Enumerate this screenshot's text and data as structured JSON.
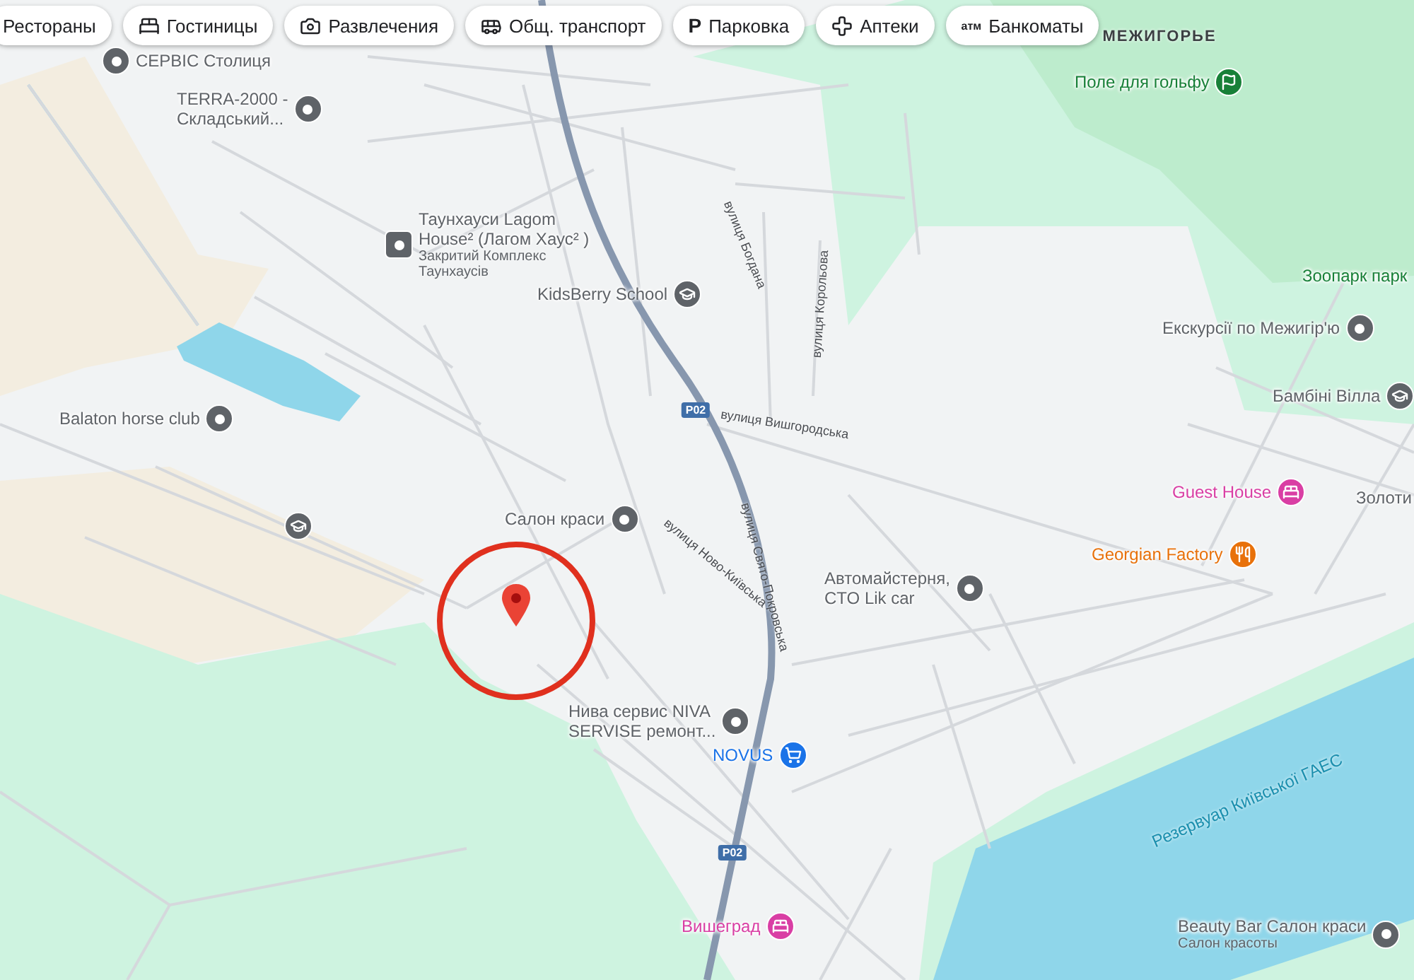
{
  "chips": [
    {
      "label": "Рестораны",
      "kind": "none"
    },
    {
      "label": "Гостиницы",
      "kind": "bed"
    },
    {
      "label": "Развлечения",
      "kind": "camera"
    },
    {
      "label": "Общ. транспорт",
      "kind": "bus"
    },
    {
      "label": "Парковка",
      "kind": "glyph",
      "glyph": "P"
    },
    {
      "label": "Аптеки",
      "kind": "pharmacy"
    },
    {
      "label": "Банкоматы",
      "kind": "glyph",
      "glyph": "атм"
    }
  ],
  "places": [
    {
      "label": "СЕРВІС Столиця",
      "kind": "pin",
      "color": "#5f6368"
    },
    {
      "label": "Поле для гольфу",
      "kind": "golf",
      "color": "#188038"
    },
    {
      "label": "TERRA-2000 -\nСкладський...",
      "kind": "pin",
      "color": "#5f6368"
    },
    {
      "label": "Таунхауси Lagom\nHouse² (Лагом Хаус² )",
      "sublabel": "Закритий Комплекс\nТаунхаусів",
      "kind": "square",
      "color": "#5f6368"
    },
    {
      "label": "Зоопарк парк",
      "kind": "none",
      "color": "#188038"
    },
    {
      "label": "KidsBerry School",
      "kind": "school",
      "color": "#5f6368"
    },
    {
      "label": "Екскурсії по Межигір'ю",
      "kind": "pin",
      "color": "#5f6368"
    },
    {
      "label": "Бамбіні Вілла",
      "kind": "school",
      "color": "#5f6368"
    },
    {
      "label": "Balaton horse club",
      "kind": "pin",
      "color": "#5f6368"
    },
    {
      "label": "Guest House",
      "kind": "bed",
      "color": "#d93ea4"
    },
    {
      "label": "Золоти",
      "kind": "none",
      "color": "#5f6368"
    },
    {
      "label": "Салон краси",
      "kind": "pin",
      "color": "#5f6368"
    },
    {
      "kind": "school",
      "color": "#5f6368"
    },
    {
      "label": "Georgian Factory",
      "kind": "food",
      "color": "#e8710a"
    },
    {
      "label": "Автомайстерня,\nCTO Lik car",
      "kind": "pin",
      "color": "#5f6368"
    },
    {
      "label": "Нива сервис NIVA\nSERVISE ремонт...",
      "kind": "pin",
      "color": "#5f6368"
    },
    {
      "label": "NOVUS",
      "kind": "cart",
      "color": "#1a73e8"
    },
    {
      "label": "Вишеград",
      "kind": "bed",
      "color": "#d93ea4"
    },
    {
      "label": "Beauty Bar Салон краси",
      "sublabel": "Салон красоты",
      "kind": "pin",
      "color": "#5f6368"
    }
  ],
  "map_labels": [
    {
      "text": "МЕЖИГОРЬЕ",
      "kind": "area"
    },
    {
      "text": "вулиця Богдана",
      "kind": "street"
    },
    {
      "text": "вулиця Корольова",
      "kind": "street"
    },
    {
      "text": "вулиця Вишгородська",
      "kind": "street"
    },
    {
      "text": "вулиця Свято-Покровська",
      "kind": "street"
    },
    {
      "text": "вулиця Ново-Київська",
      "kind": "street"
    },
    {
      "text": "Резервуар Київської ГАЕС",
      "kind": "water"
    },
    {
      "text": "P02",
      "kind": "shield"
    },
    {
      "text": "P02",
      "kind": "shield"
    }
  ],
  "marker": {
    "highlighted": true
  }
}
